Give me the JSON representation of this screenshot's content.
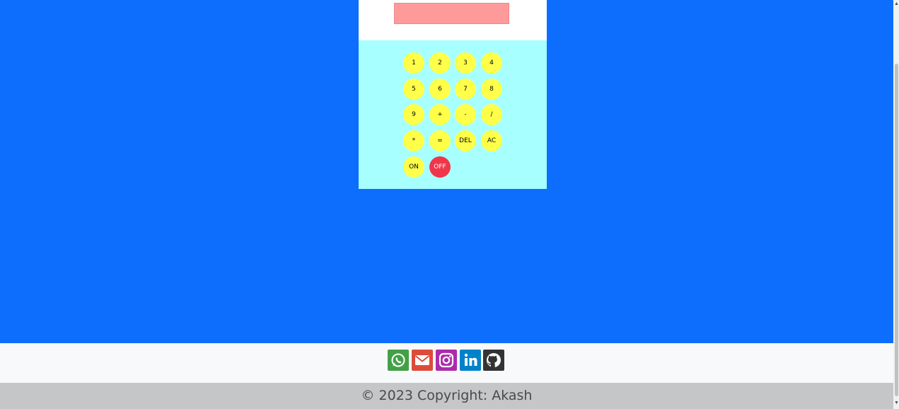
{
  "calculator": {
    "display": {
      "value": ""
    },
    "keys": [
      "1",
      "2",
      "3",
      "4",
      "5",
      "6",
      "7",
      "8",
      "9",
      "+",
      "-",
      "/",
      "*",
      "=",
      "DEL",
      "AC",
      "ON",
      "OFF"
    ]
  },
  "footer": {
    "social": [
      {
        "name": "whatsapp",
        "icon": "whatsapp-icon",
        "color": "#43a047"
      },
      {
        "name": "email",
        "icon": "envelope-icon",
        "color": "#dd4b39"
      },
      {
        "name": "instagram",
        "icon": "instagram-icon",
        "color": "#ac2bac"
      },
      {
        "name": "linkedin",
        "icon": "linkedin-icon",
        "color": "#0082ca"
      },
      {
        "name": "github",
        "icon": "github-icon",
        "color": "#333333"
      }
    ],
    "copyright": "© 2023 Copyright: Akash"
  },
  "colors": {
    "page_background": "#0d6efd",
    "display_background": "#ff9a9a",
    "keypad_background": "#a8ffff",
    "key_background": "#ffff4a",
    "off_key_background": "#f0364a"
  }
}
